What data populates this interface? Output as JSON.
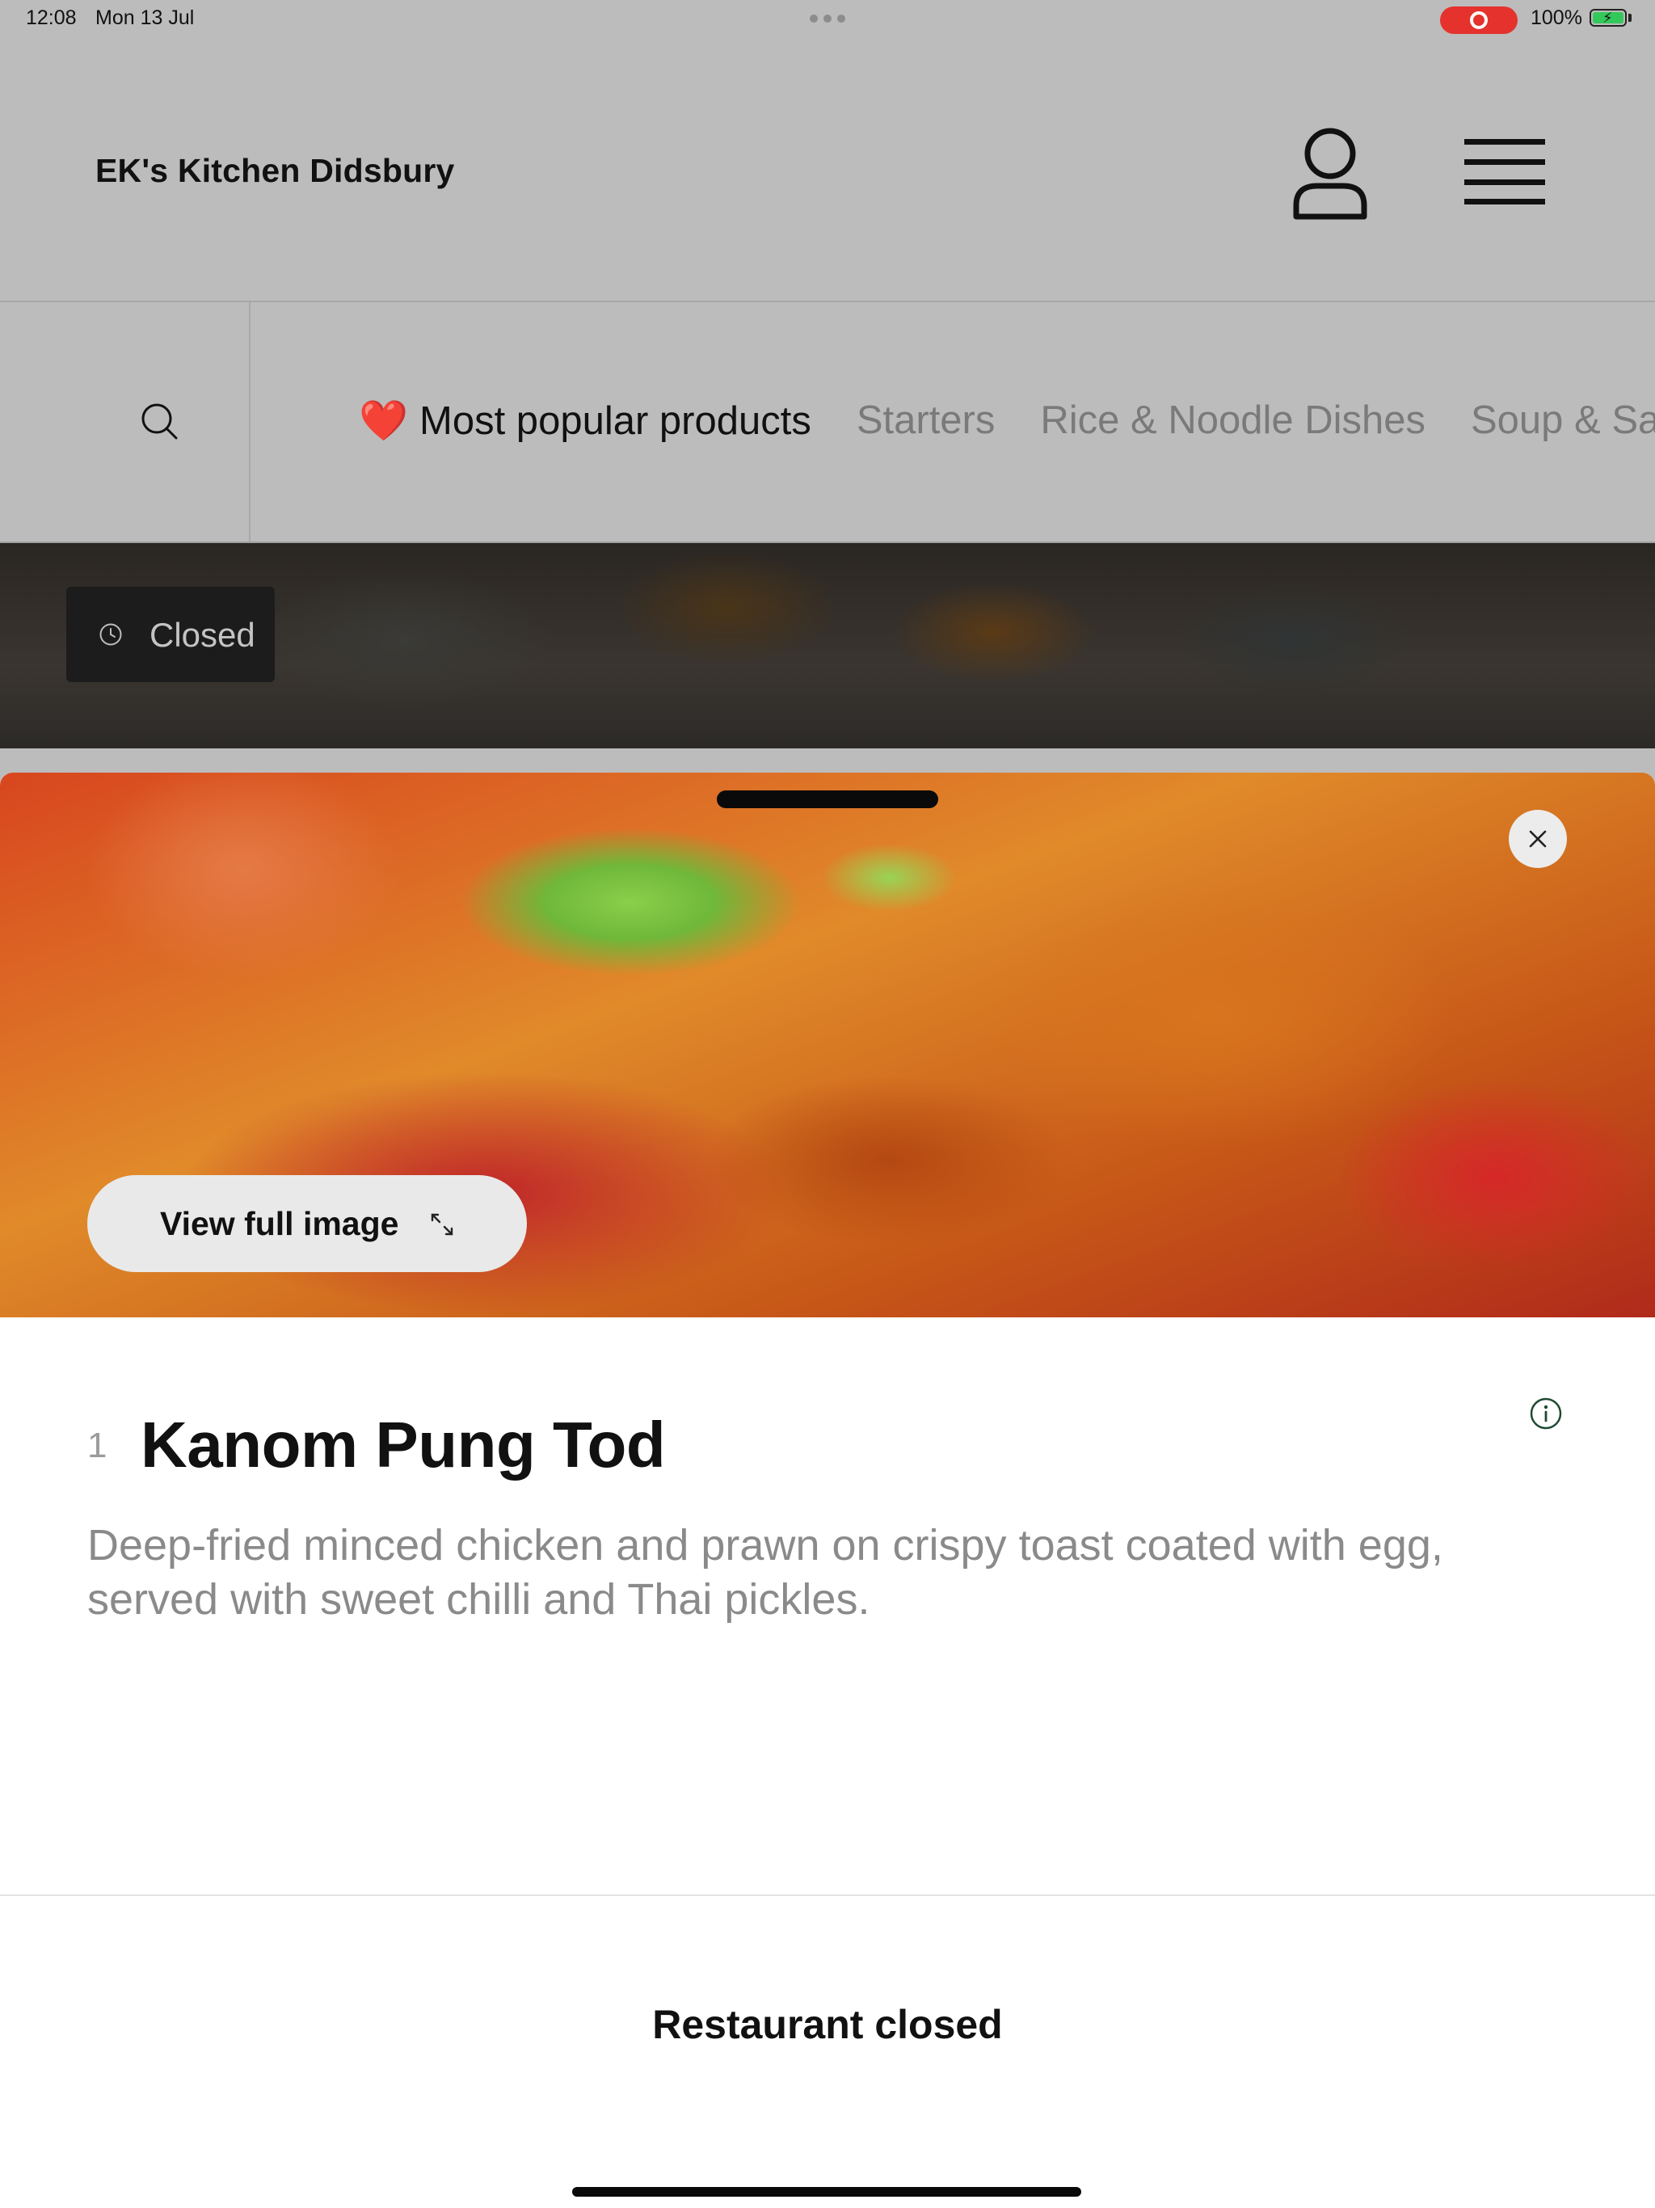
{
  "status_bar": {
    "time": "12:08",
    "date": "Mon 13 Jul",
    "battery_percent": "100%",
    "battery_level": 1.0,
    "recording_active": true,
    "battery_color": "#34c759",
    "record_color": "#e5322d"
  },
  "header": {
    "brand": "EK's Kitchen Didsbury",
    "account_icon": "person-icon",
    "menu_icon": "hamburger-menu-icon"
  },
  "categories": {
    "search_icon": "search-icon",
    "active_emoji": "❤️",
    "items": [
      {
        "label": "Most popular products",
        "active": true
      },
      {
        "label": "Starters",
        "active": false
      },
      {
        "label": "Rice & Noodle Dishes",
        "active": false
      },
      {
        "label": "Soup & Salad",
        "active": false
      }
    ]
  },
  "hero": {
    "status_label": "Closed",
    "status_icon": "clock-icon"
  },
  "product": {
    "view_full_image_label": "View full image",
    "quantity": "1",
    "name": "Kanom Pung Tod",
    "description": "Deep-fried minced chicken and prawn on crispy toast coated with egg, served with sweet chilli and Thai pickles.",
    "close_icon": "close-icon",
    "info_icon": "info-icon",
    "expand_icon": "expand-icon"
  },
  "footer": {
    "status": "Restaurant closed"
  }
}
